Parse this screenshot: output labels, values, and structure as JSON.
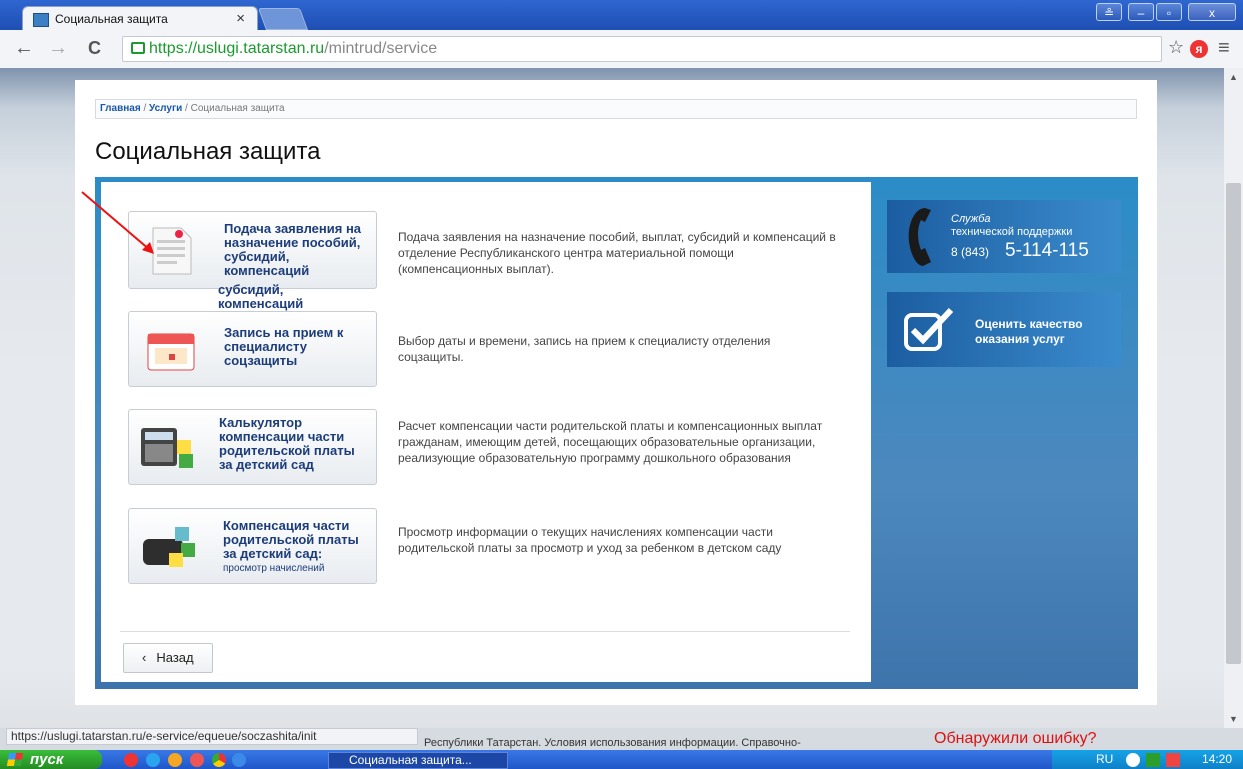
{
  "browser": {
    "tab_title": "Социальная защита",
    "tab_close": "×",
    "url_host": "https://uslugi.tatarstan.ru",
    "url_path": "/mintrud/service",
    "nav_back": "←",
    "nav_forward": "→",
    "nav_reload": "C",
    "star": "☆",
    "yandex": "я",
    "menu": "≡",
    "win_min": "–",
    "win_max": "▫",
    "win_close": "x",
    "win_user": "≗"
  },
  "breadcrumb": {
    "home": "Главная",
    "sep1": " / ",
    "services": "Услуги",
    "sep2": " / ",
    "current": "Социальная защита"
  },
  "page_title": "Социальная защита",
  "services": [
    {
      "label": "Подача заявления на назначение пособий, субсидий, компенсаций",
      "desc": "Подача заявления на назначение пособий, выплат, субсидий и компенсаций в отделение Республиканского центра материальной помощи (компенсационных выплат)."
    },
    {
      "label": "Запись на прием к специалисту соцзащиты",
      "desc": "Выбор даты и времени, запись на прием к специалисту отделения соцзащиты."
    },
    {
      "label": "Калькулятор компенсации части родительской платы за детский сад",
      "desc": "Расчет компенсации части родительской платы и компенсационных выплат гражданам, имеющим детей, посещающих образовательные организации, реализующие образовательную программу дошкольного образования"
    },
    {
      "label": "Компенсация части родительской платы за детский сад:",
      "sublabel": "просмотр начислений",
      "desc": "Просмотр информации о текущих начислениях компенсации части родительской платы за просмотр и уход за ребенком в детском саду"
    }
  ],
  "overflow_text": "субсидий, компенсаций",
  "back_button": "Назад",
  "back_chevron": "‹",
  "side": {
    "support_title1": "Служба",
    "support_title2": "технической поддержки",
    "support_phone_code": "8 (843)",
    "support_phone": "5-114-115",
    "rate_line1": "Оценить качество",
    "rate_line2": "оказания услуг"
  },
  "status_url": "https://uslugi.tatarstan.ru/e-service/equeue/soczashita/init",
  "footer_text": "Республики Татарстан. Условия использования информации. Справочно-",
  "error_link": "Обнаружили ошибку?",
  "taskbar": {
    "start": "пуск",
    "item": "Социальная защита...",
    "lang": "RU",
    "time": "14:20"
  },
  "colors": {
    "accent": "#1c3c7a",
    "panel": "#2b8cc7"
  }
}
